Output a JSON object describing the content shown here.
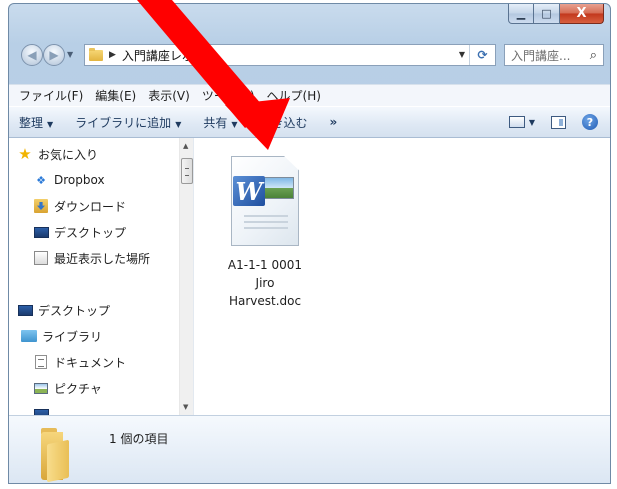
{
  "window": {
    "caption_min": "▁",
    "caption_max": "□",
    "caption_close": "X"
  },
  "address": {
    "path_text": "入門講座レポート",
    "refresh": "⟳"
  },
  "search": {
    "placeholder": "入門講座..."
  },
  "menu": [
    "ファイル(F)",
    "編集(E)",
    "表示(V)",
    "ツール(T)",
    "ヘルプ(H)"
  ],
  "toolbar": {
    "organize": "整理",
    "add_to_library": "ライブラリに追加",
    "share": "共有",
    "burn": "書き込む",
    "more": "»"
  },
  "nav_tree": {
    "favorites": "お気に入り",
    "dropbox": "Dropbox",
    "downloads": "ダウンロード",
    "desktop_fav": "デスクトップ",
    "recent": "最近表示した場所",
    "desktop": "デスクトップ",
    "libraries": "ライブラリ",
    "documents": "ドキュメント",
    "pictures": "ピクチャ"
  },
  "files": [
    {
      "name_line1": "A1-1-1 0001",
      "name_line2": "Jiro",
      "name_line3": "Harvest.doc",
      "badge": "W"
    }
  ],
  "details": {
    "item_count": "1 個の項目"
  },
  "colors": {
    "annotation_arrow": "#ff0000"
  }
}
